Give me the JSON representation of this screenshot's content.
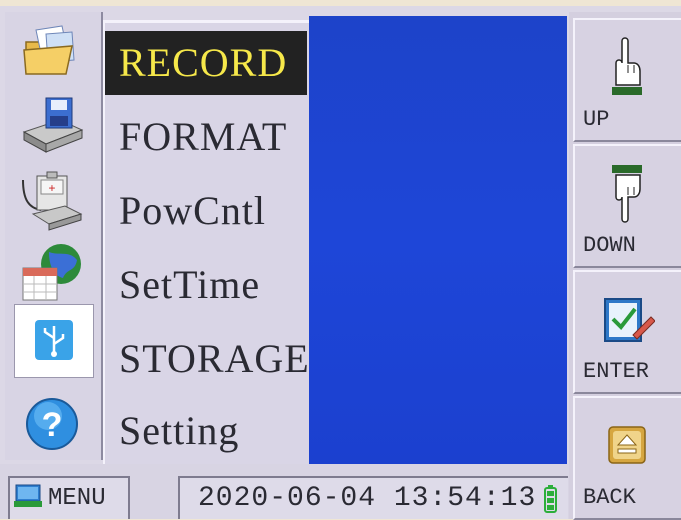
{
  "menu": {
    "items": [
      {
        "label": "RECORD",
        "selected": true
      },
      {
        "label": "FORMAT",
        "selected": false
      },
      {
        "label": "PowCntl",
        "selected": false
      },
      {
        "label": "SetTime",
        "selected": false
      },
      {
        "label": "STORAGE",
        "selected": false
      },
      {
        "label": "Setting",
        "selected": false
      }
    ],
    "icons": [
      "folder-icon",
      "floppy-drive-icon",
      "power-supply-icon",
      "globe-calendar-icon",
      "usb-icon",
      "help-icon"
    ]
  },
  "buttons": {
    "up": {
      "label": "UP",
      "icon": "hand-pointing-up-icon"
    },
    "down": {
      "label": "DOWN",
      "icon": "hand-pointing-down-icon"
    },
    "enter": {
      "label": "ENTER",
      "icon": "clipboard-check-icon"
    },
    "back": {
      "label": "BACK",
      "icon": "eject-icon"
    }
  },
  "status_bar": {
    "menu_label": "MENU",
    "datetime": "2020-06-04 13:54:13",
    "battery_icon": "battery-icon"
  },
  "colors": {
    "selected_bg": "#222222",
    "selected_text": "#f6e84a",
    "display_blue": "#1e46d8",
    "battery_green": "#2cae3a"
  }
}
